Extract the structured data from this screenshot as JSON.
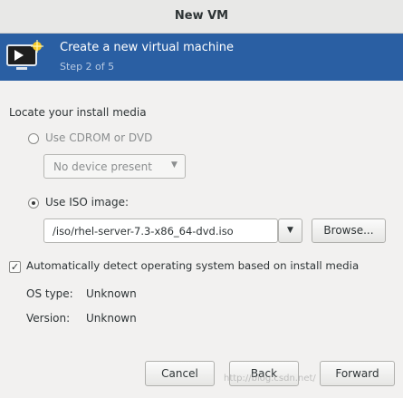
{
  "window": {
    "title": "New VM"
  },
  "header": {
    "title": "Create a new virtual machine",
    "step": "Step 2 of 5"
  },
  "install_media": {
    "section_label": "Locate your install media",
    "cdrom_label": "Use CDROM or DVD",
    "cdrom_selected": false,
    "cdrom_device_value": "No device present",
    "iso_label": "Use ISO image:",
    "iso_selected": true,
    "iso_path": "/iso/rhel-server-7.3-x86_64-dvd.iso",
    "browse_label": "Browse..."
  },
  "os_detect": {
    "checkbox_label": "Automatically detect operating system based on install media",
    "checked": true,
    "os_type_label": "OS type:",
    "os_type_value": "Unknown",
    "version_label": "Version:",
    "version_value": "Unknown"
  },
  "footer": {
    "cancel_label": "Cancel",
    "back_label": "Back",
    "forward_label": "Forward"
  },
  "watermark": "http://blog.csdn.net/"
}
